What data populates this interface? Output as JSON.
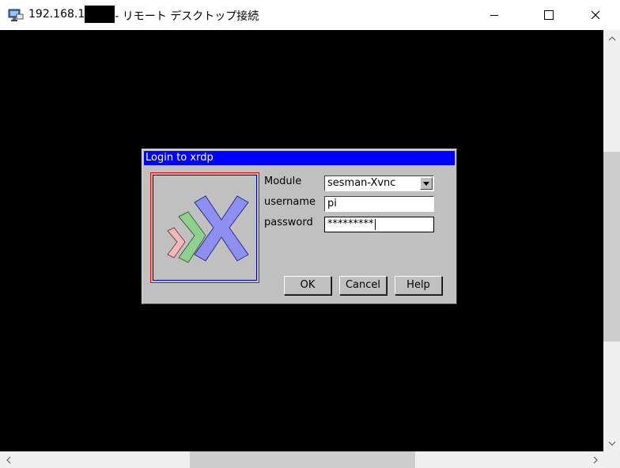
{
  "window": {
    "title_prefix": "192.168.1",
    "title_suffix": "- リモート デスクトップ接続",
    "controls": [
      "minimize-icon",
      "maximize-icon",
      "close-icon"
    ]
  },
  "dialog": {
    "title": "Login to xrdp",
    "fields": {
      "module_label": "Module",
      "module_value": "sesman-Xvnc",
      "username_label": "username",
      "username_value": "pi",
      "password_label": "password",
      "password_value": "*********"
    },
    "buttons": {
      "ok": "OK",
      "cancel": "Cancel",
      "help": "Help"
    },
    "colors": {
      "title_bar": "#0000ff",
      "dialog_bg": "#c0c0c0"
    }
  },
  "scrollbars": {
    "vertical_icons": [
      "chevron-up-icon",
      "chevron-down-icon"
    ],
    "horizontal_icons": [
      "chevron-left-icon",
      "chevron-right-icon"
    ]
  }
}
